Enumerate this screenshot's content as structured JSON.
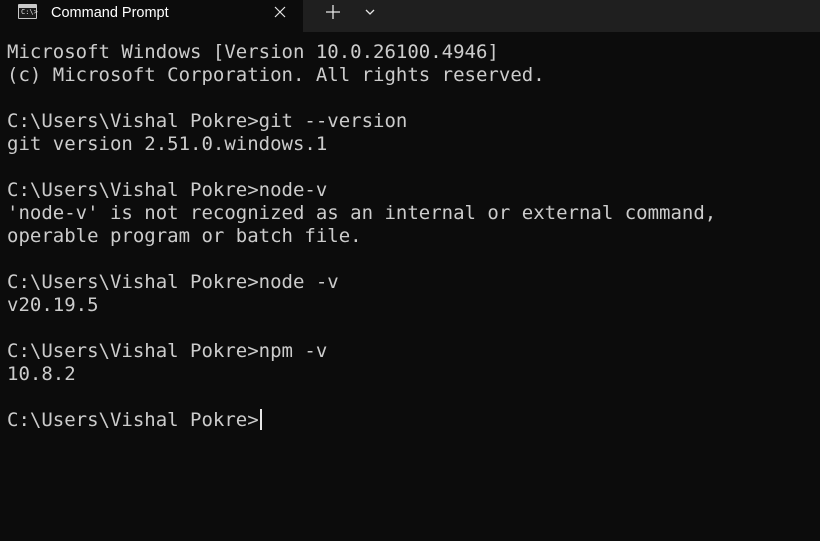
{
  "tab": {
    "title": "Command Prompt",
    "icon_prompt": "C:\\>"
  },
  "icons": {
    "tab_icon": "terminal-icon",
    "close": "close-icon",
    "new_tab": "plus-icon",
    "dropdown": "chevron-down-icon"
  },
  "colors": {
    "background": "#0c0c0c",
    "tabbar": "#1f1f1f",
    "text": "#cccccc"
  },
  "terminal": {
    "lines": [
      "Microsoft Windows [Version 10.0.26100.4946]",
      "(c) Microsoft Corporation. All rights reserved.",
      "",
      "C:\\Users\\Vishal Pokre>git --version",
      "git version 2.51.0.windows.1",
      "",
      "C:\\Users\\Vishal Pokre>node-v",
      "'node-v' is not recognized as an internal or external command,",
      "operable program or batch file.",
      "",
      "C:\\Users\\Vishal Pokre>node -v",
      "v20.19.5",
      "",
      "C:\\Users\\Vishal Pokre>npm -v",
      "10.8.2",
      "",
      "C:\\Users\\Vishal Pokre>"
    ]
  }
}
